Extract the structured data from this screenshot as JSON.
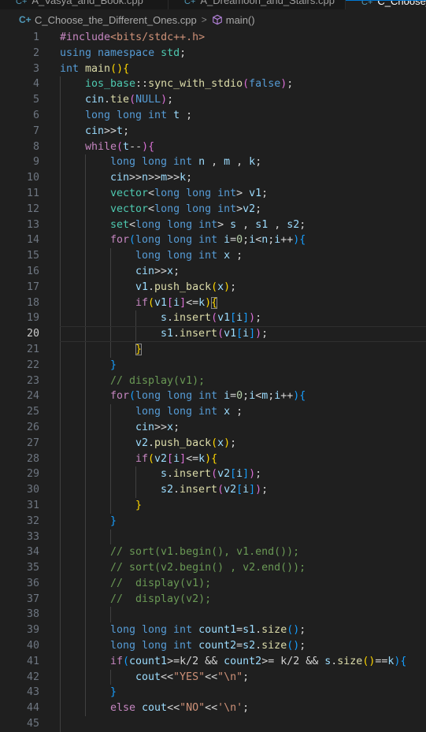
{
  "tabs": [
    {
      "label": "A_Vasya_and_Book.cpp"
    },
    {
      "label": "A_Dreamoon_and_Stairs.cpp"
    },
    {
      "label": "C_Choose_t"
    }
  ],
  "breadcrumb": {
    "file_icon": "cpp-file-icon",
    "file": "C_Choose_the_Different_Ones.cpp",
    "separator": ">",
    "function": "main()"
  },
  "editor": {
    "active_line": 20,
    "lines": [
      {
        "n": 1,
        "i": 0,
        "t": [
          [
            "c",
            "#include"
          ],
          [
            "s",
            "<bits/stdc++.h>"
          ]
        ]
      },
      {
        "n": 2,
        "i": 0,
        "t": [
          [
            "k",
            "using "
          ],
          [
            "k",
            "namespace "
          ],
          [
            "t",
            "std"
          ],
          [
            "p",
            ";"
          ]
        ]
      },
      {
        "n": 3,
        "i": 0,
        "t": [
          [
            "k",
            "int "
          ],
          [
            "f",
            "main"
          ],
          [
            "b1",
            "()"
          ],
          [
            "b1",
            "{"
          ]
        ]
      },
      {
        "n": 4,
        "i": 1,
        "t": [
          [
            "t",
            "ios_base"
          ],
          [
            "p",
            "::"
          ],
          [
            "f",
            "sync_with_stdio"
          ],
          [
            "b2",
            "("
          ],
          [
            "k",
            "false"
          ],
          [
            "b2",
            ")"
          ],
          [
            "p",
            ";"
          ]
        ]
      },
      {
        "n": 5,
        "i": 1,
        "t": [
          [
            "v",
            "cin"
          ],
          [
            "p",
            "."
          ],
          [
            "f",
            "tie"
          ],
          [
            "b2",
            "("
          ],
          [
            "k",
            "NULL"
          ],
          [
            "b2",
            ")"
          ],
          [
            "p",
            ";"
          ]
        ]
      },
      {
        "n": 6,
        "i": 1,
        "t": [
          [
            "k",
            "long long int "
          ],
          [
            "v",
            "t"
          ],
          [
            "p",
            " ;"
          ]
        ]
      },
      {
        "n": 7,
        "i": 1,
        "t": [
          [
            "v",
            "cin"
          ],
          [
            "p",
            ">>"
          ],
          [
            "v",
            "t"
          ],
          [
            "p",
            ";"
          ]
        ]
      },
      {
        "n": 8,
        "i": 1,
        "t": [
          [
            "c",
            "while"
          ],
          [
            "b2",
            "("
          ],
          [
            "v",
            "t"
          ],
          [
            "p",
            "--"
          ],
          [
            "b2",
            ")"
          ],
          [
            "b2",
            "{"
          ]
        ]
      },
      {
        "n": 9,
        "i": 2,
        "t": [
          [
            "k",
            "long long int "
          ],
          [
            "v",
            "n"
          ],
          [
            "p",
            " , "
          ],
          [
            "v",
            "m"
          ],
          [
            "p",
            " , "
          ],
          [
            "v",
            "k"
          ],
          [
            "p",
            ";"
          ]
        ]
      },
      {
        "n": 10,
        "i": 2,
        "t": [
          [
            "v",
            "cin"
          ],
          [
            "p",
            ">>"
          ],
          [
            "v",
            "n"
          ],
          [
            "p",
            ">>"
          ],
          [
            "v",
            "m"
          ],
          [
            "p",
            ">>"
          ],
          [
            "v",
            "k"
          ],
          [
            "p",
            ";"
          ]
        ]
      },
      {
        "n": 11,
        "i": 2,
        "t": [
          [
            "t",
            "vector"
          ],
          [
            "p",
            "<"
          ],
          [
            "k",
            "long long int"
          ],
          [
            "p",
            "> "
          ],
          [
            "v",
            "v1"
          ],
          [
            "p",
            ";"
          ]
        ]
      },
      {
        "n": 12,
        "i": 2,
        "t": [
          [
            "t",
            "vector"
          ],
          [
            "p",
            "<"
          ],
          [
            "k",
            "long long int"
          ],
          [
            "p",
            ">"
          ],
          [
            "v",
            "v2"
          ],
          [
            "p",
            ";"
          ]
        ]
      },
      {
        "n": 13,
        "i": 2,
        "t": [
          [
            "t",
            "set"
          ],
          [
            "p",
            "<"
          ],
          [
            "k",
            "long long int"
          ],
          [
            "p",
            "> "
          ],
          [
            "v",
            "s"
          ],
          [
            "p",
            " , "
          ],
          [
            "v",
            "s1"
          ],
          [
            "p",
            " , "
          ],
          [
            "v",
            "s2"
          ],
          [
            "p",
            ";"
          ]
        ]
      },
      {
        "n": 14,
        "i": 2,
        "t": [
          [
            "c",
            "for"
          ],
          [
            "b3",
            "("
          ],
          [
            "k",
            "long long int "
          ],
          [
            "v",
            "i"
          ],
          [
            "p",
            "="
          ],
          [
            "n",
            "0"
          ],
          [
            "p",
            ";"
          ],
          [
            "v",
            "i"
          ],
          [
            "p",
            "<"
          ],
          [
            "v",
            "n"
          ],
          [
            "p",
            ";"
          ],
          [
            "v",
            "i"
          ],
          [
            "p",
            "++"
          ],
          [
            "b3",
            ")"
          ],
          [
            "b3",
            "{"
          ]
        ]
      },
      {
        "n": 15,
        "i": 3,
        "t": [
          [
            "k",
            "long long int "
          ],
          [
            "v",
            "x"
          ],
          [
            "p",
            " ;"
          ]
        ]
      },
      {
        "n": 16,
        "i": 3,
        "t": [
          [
            "v",
            "cin"
          ],
          [
            "p",
            ">>"
          ],
          [
            "v",
            "x"
          ],
          [
            "p",
            ";"
          ]
        ]
      },
      {
        "n": 17,
        "i": 3,
        "t": [
          [
            "v",
            "v1"
          ],
          [
            "p",
            "."
          ],
          [
            "f",
            "push_back"
          ],
          [
            "b1",
            "("
          ],
          [
            "v",
            "x"
          ],
          [
            "b1",
            ")"
          ],
          [
            "p",
            ";"
          ]
        ]
      },
      {
        "n": 18,
        "i": 3,
        "t": [
          [
            "c",
            "if"
          ],
          [
            "b1",
            "("
          ],
          [
            "v",
            "v1"
          ],
          [
            "b2",
            "["
          ],
          [
            "v",
            "i"
          ],
          [
            "b2",
            "]"
          ],
          [
            "p",
            "<="
          ],
          [
            "v",
            "k"
          ],
          [
            "b1",
            ")"
          ],
          [
            "b1m",
            "{"
          ]
        ]
      },
      {
        "n": 19,
        "i": 4,
        "t": [
          [
            "v",
            "s"
          ],
          [
            "p",
            "."
          ],
          [
            "f",
            "insert"
          ],
          [
            "b2",
            "("
          ],
          [
            "v",
            "v1"
          ],
          [
            "b3",
            "["
          ],
          [
            "v",
            "i"
          ],
          [
            "b3",
            "]"
          ],
          [
            "b2",
            ")"
          ],
          [
            "p",
            ";"
          ]
        ]
      },
      {
        "n": 20,
        "i": 4,
        "t": [
          [
            "v",
            "s1"
          ],
          [
            "p",
            "."
          ],
          [
            "f",
            "insert"
          ],
          [
            "b2",
            "("
          ],
          [
            "v",
            "v1"
          ],
          [
            "b3",
            "["
          ],
          [
            "v",
            "i"
          ],
          [
            "b3",
            "]"
          ],
          [
            "b2",
            ")"
          ],
          [
            "p",
            ";"
          ]
        ]
      },
      {
        "n": 21,
        "i": 3,
        "t": [
          [
            "b1m",
            "}"
          ]
        ]
      },
      {
        "n": 22,
        "i": 2,
        "t": [
          [
            "b3",
            "}"
          ]
        ]
      },
      {
        "n": 23,
        "i": 2,
        "t": [
          [
            "cm",
            "// display(v1);"
          ]
        ]
      },
      {
        "n": 24,
        "i": 2,
        "t": [
          [
            "c",
            "for"
          ],
          [
            "b3",
            "("
          ],
          [
            "k",
            "long long int "
          ],
          [
            "v",
            "i"
          ],
          [
            "p",
            "="
          ],
          [
            "n",
            "0"
          ],
          [
            "p",
            ";"
          ],
          [
            "v",
            "i"
          ],
          [
            "p",
            "<"
          ],
          [
            "v",
            "m"
          ],
          [
            "p",
            ";"
          ],
          [
            "v",
            "i"
          ],
          [
            "p",
            "++"
          ],
          [
            "b3",
            ")"
          ],
          [
            "b3",
            "{"
          ]
        ]
      },
      {
        "n": 25,
        "i": 3,
        "t": [
          [
            "k",
            "long long int "
          ],
          [
            "v",
            "x"
          ],
          [
            "p",
            " ;"
          ]
        ]
      },
      {
        "n": 26,
        "i": 3,
        "t": [
          [
            "v",
            "cin"
          ],
          [
            "p",
            ">>"
          ],
          [
            "v",
            "x"
          ],
          [
            "p",
            ";"
          ]
        ]
      },
      {
        "n": 27,
        "i": 3,
        "t": [
          [
            "v",
            "v2"
          ],
          [
            "p",
            "."
          ],
          [
            "f",
            "push_back"
          ],
          [
            "b1",
            "("
          ],
          [
            "v",
            "x"
          ],
          [
            "b1",
            ")"
          ],
          [
            "p",
            ";"
          ]
        ]
      },
      {
        "n": 28,
        "i": 3,
        "t": [
          [
            "c",
            "if"
          ],
          [
            "b1",
            "("
          ],
          [
            "v",
            "v2"
          ],
          [
            "b2",
            "["
          ],
          [
            "v",
            "i"
          ],
          [
            "b2",
            "]"
          ],
          [
            "p",
            "<="
          ],
          [
            "v",
            "k"
          ],
          [
            "b1",
            ")"
          ],
          [
            "b1",
            "{"
          ]
        ]
      },
      {
        "n": 29,
        "i": 4,
        "t": [
          [
            "v",
            "s"
          ],
          [
            "p",
            "."
          ],
          [
            "f",
            "insert"
          ],
          [
            "b2",
            "("
          ],
          [
            "v",
            "v2"
          ],
          [
            "b3",
            "["
          ],
          [
            "v",
            "i"
          ],
          [
            "b3",
            "]"
          ],
          [
            "b2",
            ")"
          ],
          [
            "p",
            ";"
          ]
        ]
      },
      {
        "n": 30,
        "i": 4,
        "t": [
          [
            "v",
            "s2"
          ],
          [
            "p",
            "."
          ],
          [
            "f",
            "insert"
          ],
          [
            "b2",
            "("
          ],
          [
            "v",
            "v2"
          ],
          [
            "b3",
            "["
          ],
          [
            "v",
            "i"
          ],
          [
            "b3",
            "]"
          ],
          [
            "b2",
            ")"
          ],
          [
            "p",
            ";"
          ]
        ]
      },
      {
        "n": 31,
        "i": 3,
        "t": [
          [
            "b1",
            "}"
          ]
        ]
      },
      {
        "n": 32,
        "i": 2,
        "t": [
          [
            "b3",
            "}"
          ]
        ]
      },
      {
        "n": 33,
        "i": 0,
        "t": []
      },
      {
        "n": 34,
        "i": 2,
        "t": [
          [
            "cm",
            "// sort(v1.begin(), v1.end());"
          ]
        ]
      },
      {
        "n": 35,
        "i": 2,
        "t": [
          [
            "cm",
            "// sort(v2.begin() , v2.end());"
          ]
        ]
      },
      {
        "n": 36,
        "i": 2,
        "t": [
          [
            "cm",
            "//  display(v1);"
          ]
        ]
      },
      {
        "n": 37,
        "i": 2,
        "t": [
          [
            "cm",
            "//  display(v2);"
          ]
        ]
      },
      {
        "n": 38,
        "i": 0,
        "t": []
      },
      {
        "n": 39,
        "i": 2,
        "t": [
          [
            "k",
            "long long int "
          ],
          [
            "v",
            "count1"
          ],
          [
            "p",
            "="
          ],
          [
            "v",
            "s1"
          ],
          [
            "p",
            "."
          ],
          [
            "f",
            "size"
          ],
          [
            "b3",
            "()"
          ],
          [
            "p",
            ";"
          ]
        ]
      },
      {
        "n": 40,
        "i": 2,
        "t": [
          [
            "k",
            "long long int "
          ],
          [
            "v",
            "count2"
          ],
          [
            "p",
            "="
          ],
          [
            "v",
            "s2"
          ],
          [
            "p",
            "."
          ],
          [
            "f",
            "size"
          ],
          [
            "b3",
            "()"
          ],
          [
            "p",
            ";"
          ]
        ]
      },
      {
        "n": 41,
        "i": 2,
        "t": [
          [
            "c",
            "if"
          ],
          [
            "b3",
            "("
          ],
          [
            "v",
            "count1"
          ],
          [
            "p",
            ">=k/2 && "
          ],
          [
            "v",
            "count2"
          ],
          [
            "p",
            ">= k/2 && "
          ],
          [
            "v",
            "s"
          ],
          [
            "p",
            "."
          ],
          [
            "f",
            "size"
          ],
          [
            "b1",
            "()"
          ],
          [
            "p",
            "=="
          ],
          [
            "v",
            "k"
          ],
          [
            "b3",
            ")"
          ],
          [
            "b3",
            "{"
          ]
        ]
      },
      {
        "n": 42,
        "i": 3,
        "t": [
          [
            "v",
            "cout"
          ],
          [
            "p",
            "<<"
          ],
          [
            "s",
            "\"YES\""
          ],
          [
            "p",
            "<<"
          ],
          [
            "s",
            "\"\\n\""
          ],
          [
            "p",
            ";"
          ]
        ]
      },
      {
        "n": 43,
        "i": 2,
        "t": [
          [
            "b3",
            "}"
          ]
        ]
      },
      {
        "n": 44,
        "i": 2,
        "t": [
          [
            "c",
            "else "
          ],
          [
            "v",
            "cout"
          ],
          [
            "p",
            "<<"
          ],
          [
            "s",
            "\"NO\""
          ],
          [
            "p",
            "<<"
          ],
          [
            "s",
            "'\\n'"
          ],
          [
            "p",
            ";"
          ]
        ]
      },
      {
        "n": 45,
        "i": 0,
        "t": []
      }
    ]
  }
}
